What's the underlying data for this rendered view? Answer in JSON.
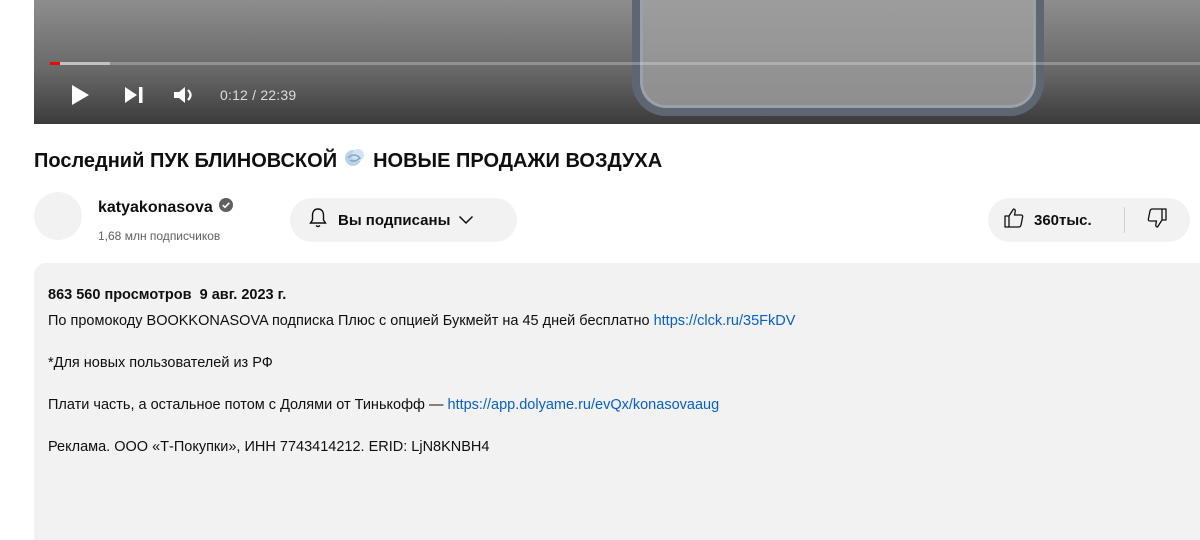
{
  "player": {
    "time_display": "0:12 / 22:39",
    "progress_fraction": 0.009,
    "buffer_fraction": 0.052,
    "played_color": "#ff0000",
    "controls": {
      "play_icon": "play-icon",
      "next_icon": "next-icon",
      "volume_icon": "volume-icon"
    }
  },
  "video": {
    "title_part1": "Последний ПУК БЛИНОВСКОЙ",
    "title_icon": "dashing-away-icon",
    "title_part2": "НОВЫЕ ПРОДАЖИ ВОЗДУХА"
  },
  "channel": {
    "name": "katyakonasova",
    "verified": true,
    "subscribers": "1,68 млн подписчиков",
    "subscribe_label": "Вы подписаны"
  },
  "actions": {
    "like_count": "360тыс."
  },
  "description": {
    "views": "863 560 просмотров",
    "date": "9 авг. 2023 г.",
    "line1_text": "По промокоду BOOKKONASOVA подписка Плюс с опцией Букмейт на 45 дней бесплатно ",
    "line1_link": "https://clck.ru/35FkDV",
    "line2_text": "*Для новых пользователей из РФ",
    "line3_text": "Плати часть, а остальное потом с Долями от Тинькофф — ",
    "line3_link": "https://app.dolyame.ru/evQx/konasovaaug",
    "line4_text": "Реклама. ООО «Т-Покупки», ИНН 7743414212. ERID: LjN8KNBH4",
    "link_color": "#065fd4"
  }
}
